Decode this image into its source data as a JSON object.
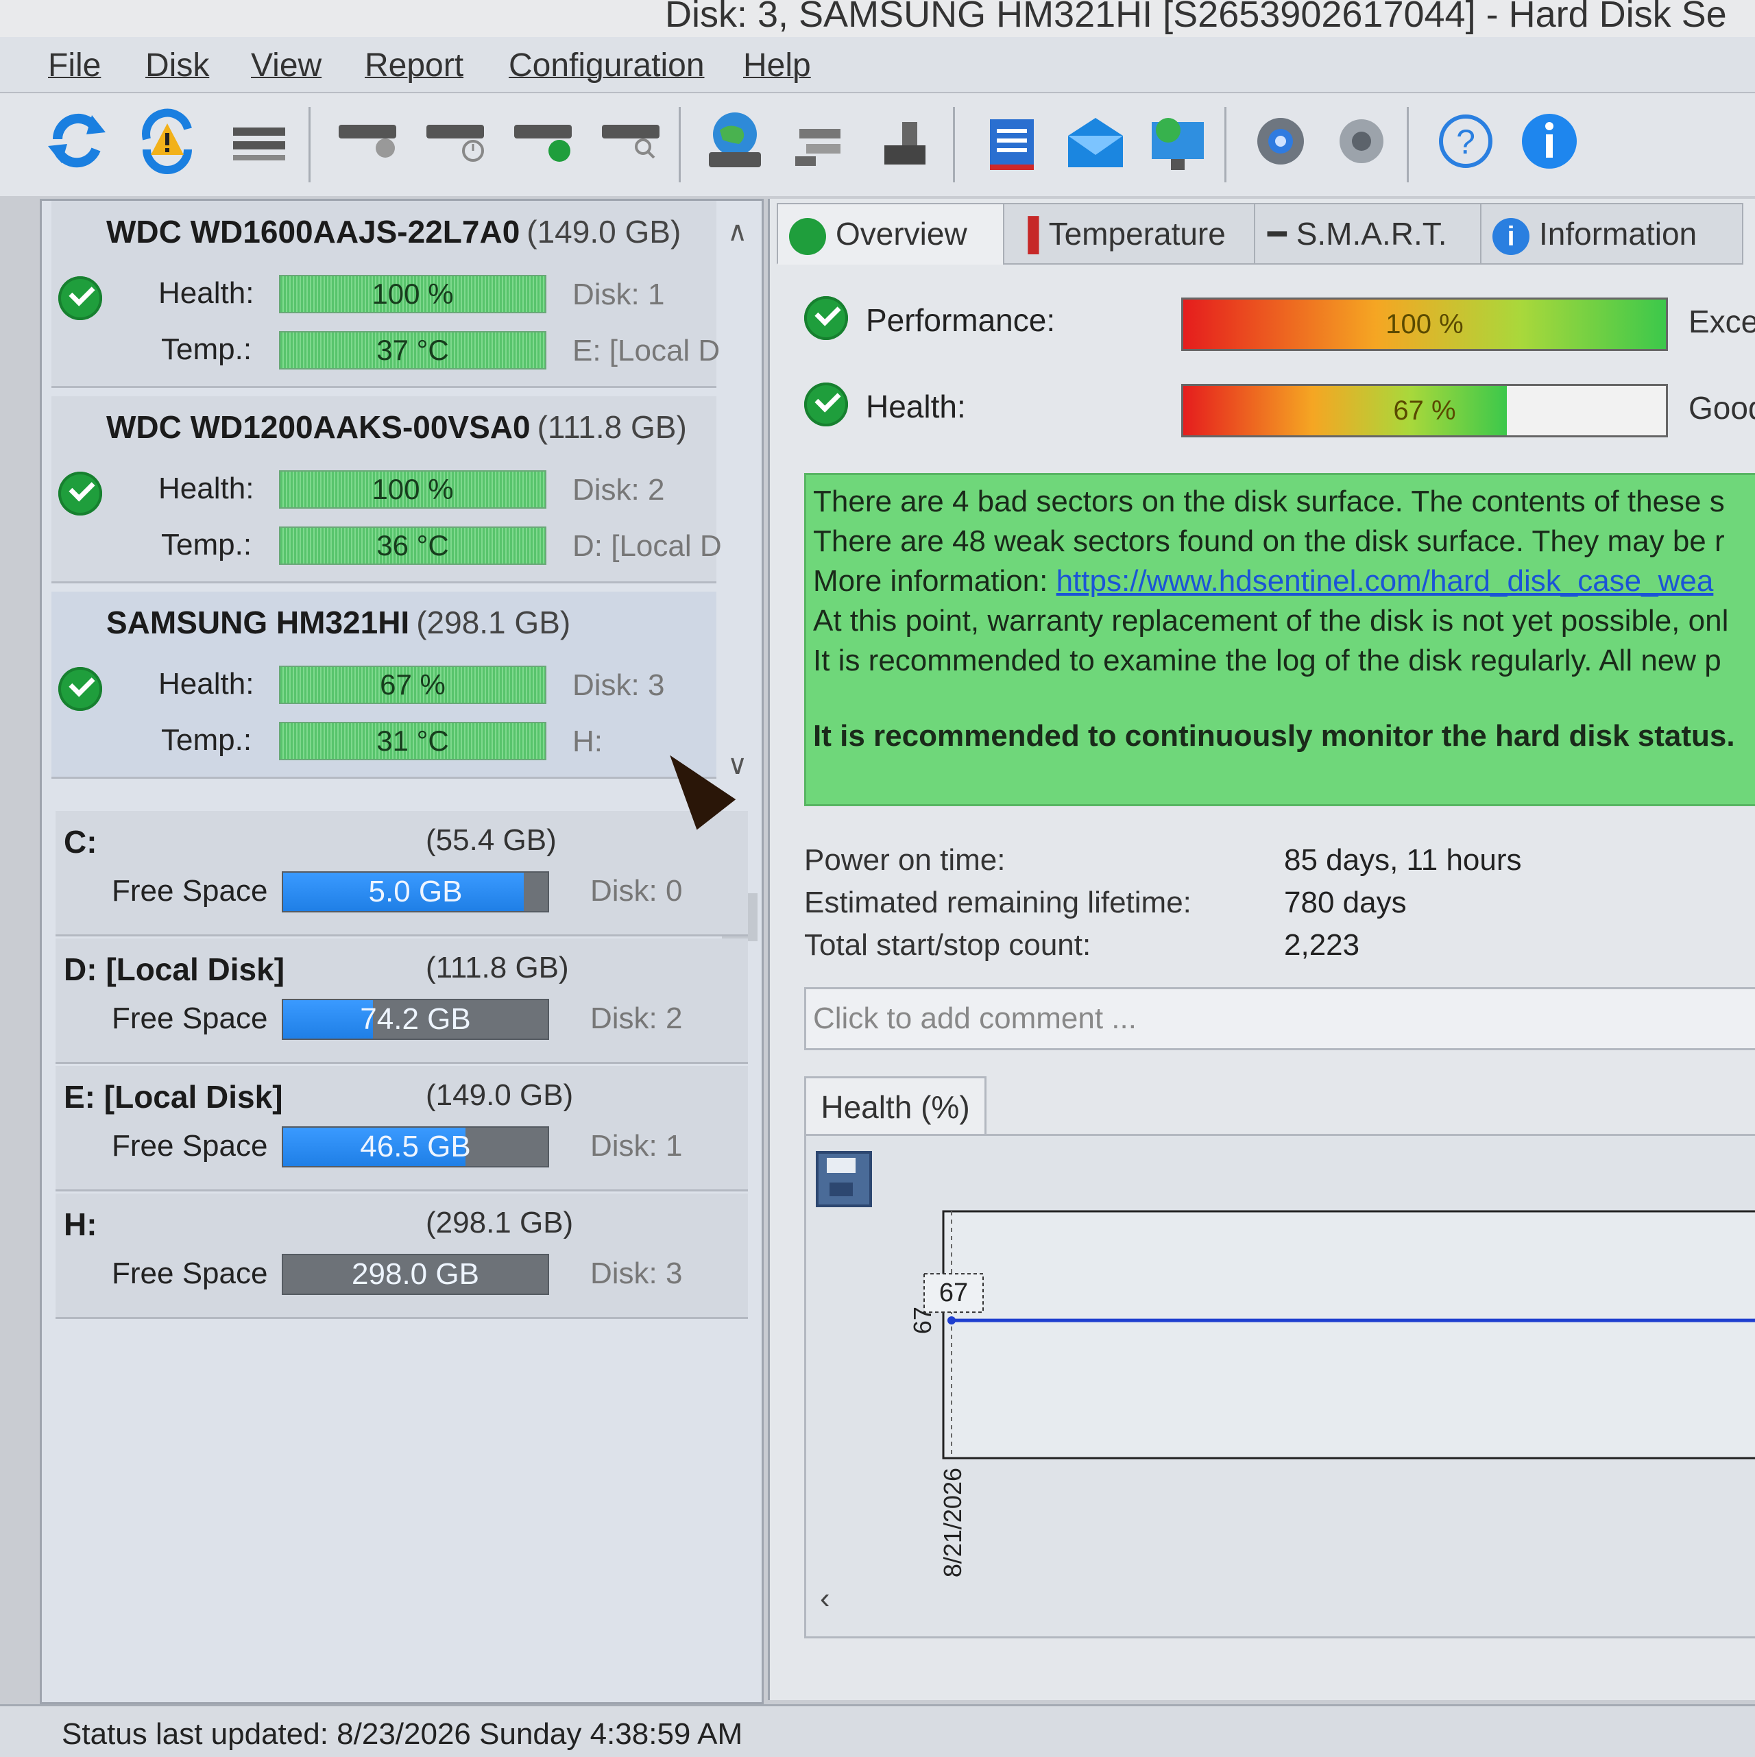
{
  "window": {
    "title": "Disk: 3, SAMSUNG HM321HI [S2653902617044]  -  Hard Disk Se"
  },
  "menu": [
    "File",
    "Disk",
    "View",
    "Report",
    "Configuration",
    "Help"
  ],
  "disks": [
    {
      "name": "WDC WD1600AAJS-22L7A0",
      "size": "(149.0 GB)",
      "health_label": "Health:",
      "health": "100 %",
      "health_value": 100,
      "temp_label": "Temp.:",
      "temp": "37 °C",
      "disk_note": "Disk: 1",
      "vol_note": "E: [Local D"
    },
    {
      "name": "WDC WD1200AAKS-00VSA0",
      "size": "(111.8 GB)",
      "health_label": "Health:",
      "health": "100 %",
      "health_value": 100,
      "temp_label": "Temp.:",
      "temp": "36 °C",
      "disk_note": "Disk: 2",
      "vol_note": "D: [Local D"
    },
    {
      "name": "SAMSUNG HM321HI",
      "size": "(298.1 GB)",
      "health_label": "Health:",
      "health": "67 %",
      "health_value": 67,
      "temp_label": "Temp.:",
      "temp": "31 °C",
      "disk_note": "Disk: 3",
      "vol_note": "H:"
    }
  ],
  "volumes": [
    {
      "name": "C:",
      "size": "(55.4 GB)",
      "free_label": "Free Space",
      "free": "5.0 GB",
      "used_fraction": 0.91,
      "disk": "Disk: 0"
    },
    {
      "name": "D: [Local Disk]",
      "size": "(111.8 GB)",
      "free_label": "Free Space",
      "free": "74.2 GB",
      "used_fraction": 0.34,
      "disk": "Disk: 2"
    },
    {
      "name": "E: [Local Disk]",
      "size": "(149.0 GB)",
      "free_label": "Free Space",
      "free": "46.5 GB",
      "used_fraction": 0.69,
      "disk": "Disk: 1"
    },
    {
      "name": "H:",
      "size": "(298.1 GB)",
      "free_label": "Free Space",
      "free": "298.0 GB",
      "used_fraction": 0.0,
      "disk": "Disk: 3"
    }
  ],
  "tabs": [
    "Overview",
    "Temperature",
    "S.M.A.R.T.",
    "Information"
  ],
  "overview": {
    "performance_label": "Performance:",
    "performance": "100 %",
    "performance_value": 100,
    "performance_word": "Exce",
    "health_label": "Health:",
    "health": "67 %",
    "health_value": 67,
    "health_word": "Good",
    "messages": [
      "There are 4 bad sectors on the disk surface. The contents of these s",
      "There are 48 weak sectors found on the disk surface. They may be r",
      "More information: ",
      "At this point, warranty replacement of the disk is not yet possible, onl",
      "It is recommended to examine the log of the disk regularly. All new p",
      "It is recommended to continuously monitor the hard disk status."
    ],
    "link": "https://www.hdsentinel.com/hard_disk_case_wea",
    "power_on_label": "Power on time:",
    "power_on": "85 days, 11 hours",
    "lifetime_label": "Estimated remaining lifetime:",
    "lifetime": "780 days",
    "startstop_label": "Total start/stop count:",
    "startstop": "2,223",
    "comment_placeholder": "Click to add comment ..."
  },
  "chart_data": {
    "type": "line",
    "title": "Health (%)",
    "x": [
      "8/21/2026"
    ],
    "series": [
      {
        "values": [
          67
        ]
      }
    ],
    "point_label": "67",
    "ytick": "67"
  },
  "status": "Status last updated: 8/23/2026 Sunday 4:38:59 AM",
  "colors": {
    "health_green": "#58c46c",
    "free_blue": "#1f7fe6",
    "message_green": "#6fd77a",
    "chart_line": "#1f3fcf"
  }
}
